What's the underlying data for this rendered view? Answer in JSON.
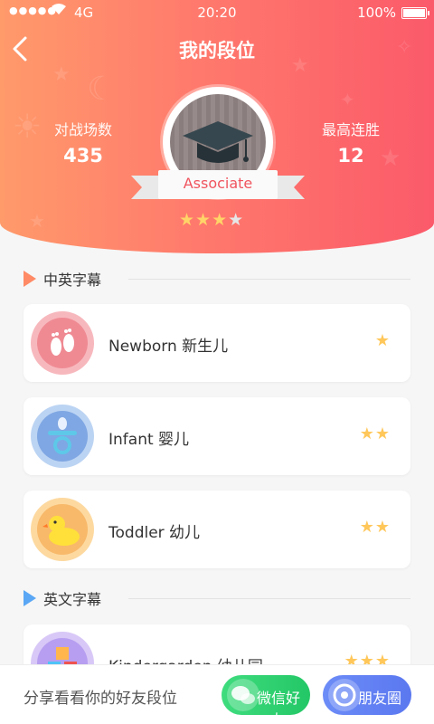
{
  "status_bar": {
    "signal": "●●●●●",
    "carrier": "4G",
    "time": "20:20",
    "battery": "100%"
  },
  "header": {
    "title": "我的段位",
    "stat_left": {
      "label": "对战场数",
      "value": "435"
    },
    "stat_right": {
      "label": "最高连胜",
      "value": "12"
    },
    "rank_name": "Associate",
    "rank_stars": 3,
    "rank_stars_total": 4
  },
  "sections": [
    {
      "title": "中英字幕",
      "accent": "#ff8a65",
      "items": [
        {
          "name": "Newborn 新生儿",
          "stars": "★",
          "icon": "baby-feet-icon"
        },
        {
          "name": "Infant 婴儿",
          "stars": "★★",
          "icon": "pacifier-icon"
        },
        {
          "name": "Toddler 幼儿",
          "stars": "★★",
          "icon": "rubber-duck-icon"
        }
      ]
    },
    {
      "title": "英文字幕",
      "accent": "#5aa7f5",
      "items": [
        {
          "name": "Kindergarden 幼儿园",
          "stars": "★★★",
          "icon": "alphabet-blocks-icon"
        }
      ]
    }
  ],
  "bottom": {
    "share_text": "分享看看你的好友段位",
    "wechat_label": "微信好友",
    "moments_label": "朋友圈"
  },
  "colors": {
    "header_start": "#ff9a6b",
    "header_end": "#fb5a6a",
    "star": "#ffc75a",
    "wechat": "#2fd173",
    "moments": "#6384f4"
  }
}
